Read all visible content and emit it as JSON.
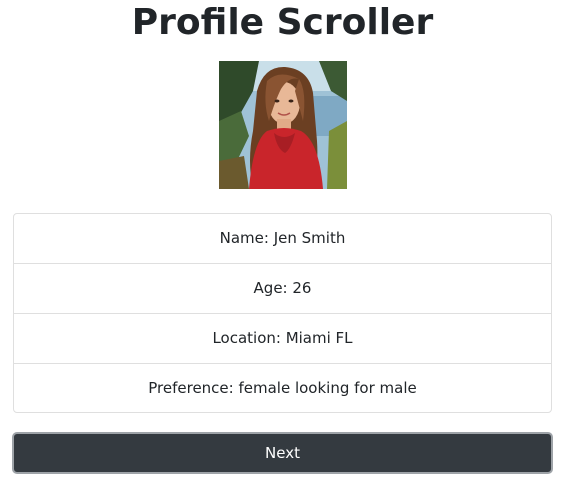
{
  "page": {
    "title": "Profile Scroller"
  },
  "profile": {
    "photo_icon": "profile-photo",
    "details": [
      "Name: Jen Smith",
      "Age: 26",
      "Location: Miami FL",
      "Preference: female looking for male"
    ]
  },
  "actions": {
    "next_label": "Next"
  },
  "colors": {
    "button_bg": "#343a40",
    "button_border": "#9ea3a8",
    "text": "#212529",
    "list_border": "#dfdfdf"
  }
}
